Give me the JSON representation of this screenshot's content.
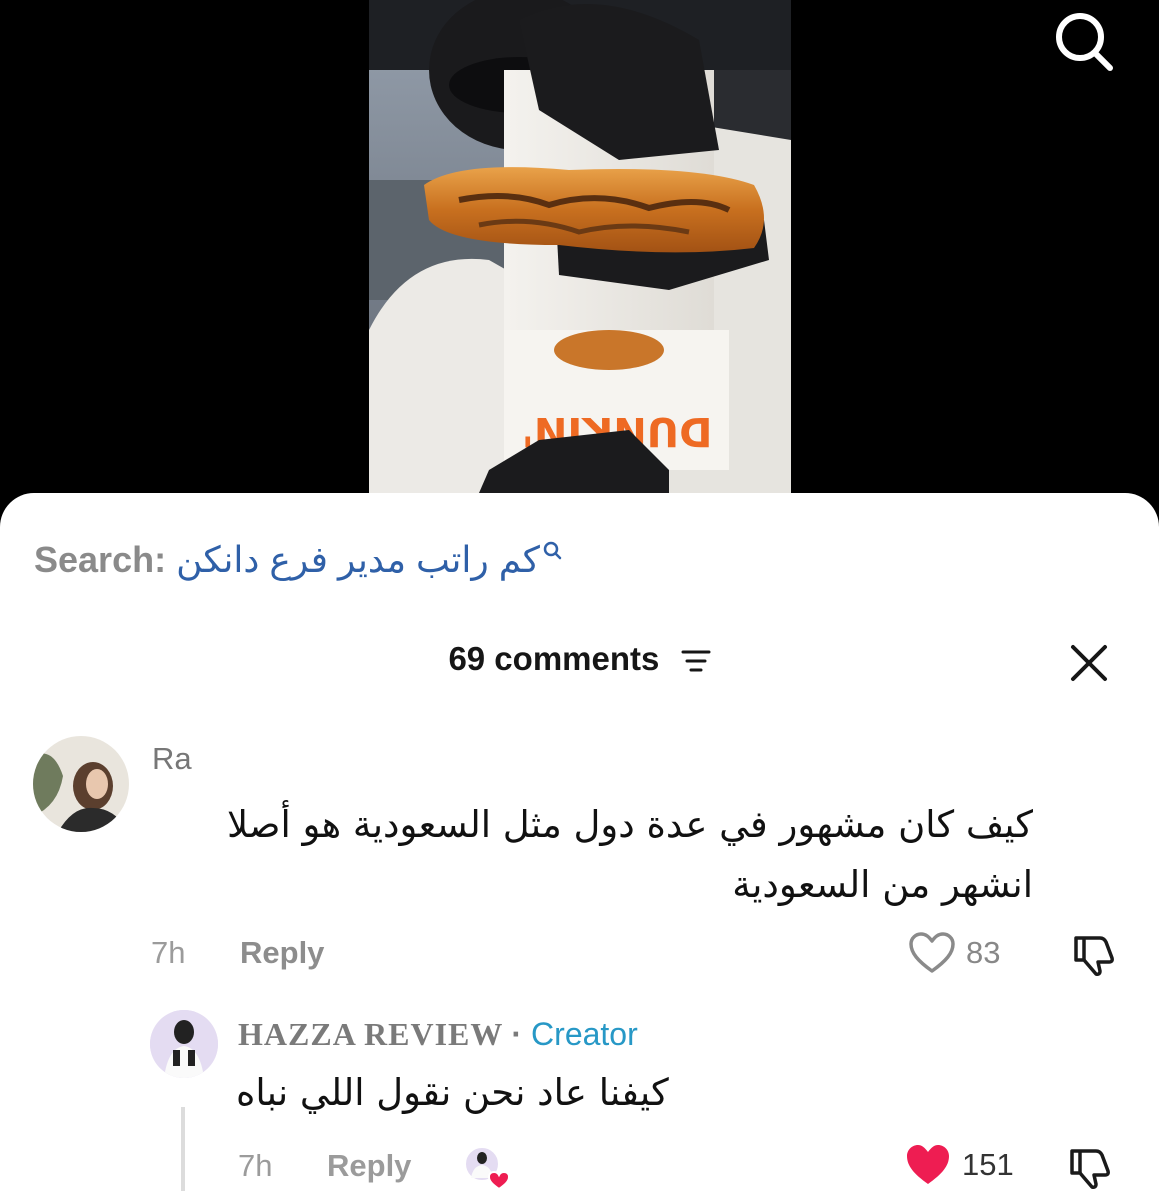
{
  "search": {
    "prefix": "Search:",
    "query": "كم راتب مدير فرع دانكن"
  },
  "comments_header": {
    "count_label": "69 comments"
  },
  "comment": {
    "username": "Ra",
    "text": "كيف كان مشهور في عدة دول مثل السعودية هو أصلا انشهر من السعودية",
    "time": "7h",
    "reply_label": "Reply",
    "likes": "83"
  },
  "reply": {
    "username": "HAZZA REVIEW",
    "separator": "·",
    "badge": "Creator",
    "text": "كيفنا عاد نحن نقول اللي نباه",
    "time": "7h",
    "reply_label": "Reply",
    "likes": "151"
  },
  "video": {
    "box_brand_text": "DUNKIN'"
  },
  "colors": {
    "search_query": "#2f60a8",
    "creator_badge": "#2798c6",
    "liked_heart": "#ee1d52",
    "dunkin_orange": "#ee6a23",
    "dunkin_pink": "#d8237a"
  },
  "icons": {
    "top_search": "search-icon",
    "filter": "sort-lines-icon",
    "close": "close-icon",
    "like": "heart-outline-icon",
    "liked": "heart-filled-icon",
    "dislike": "thumbs-down-icon"
  }
}
